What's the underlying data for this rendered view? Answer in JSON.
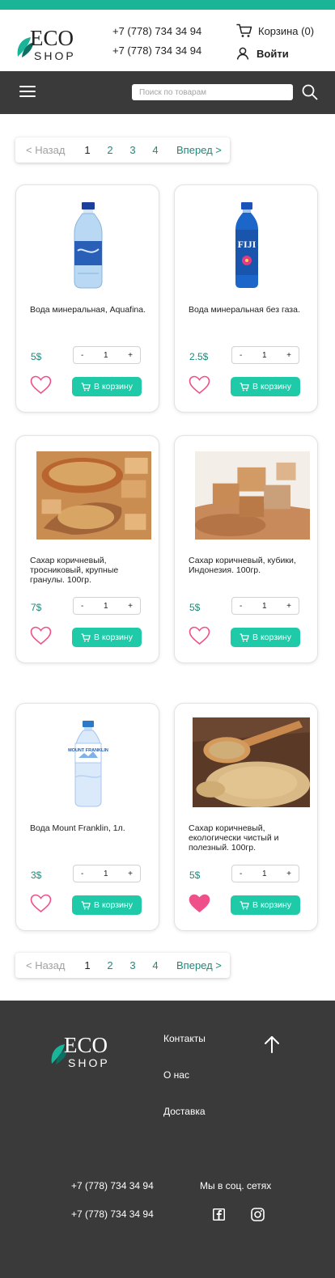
{
  "brand": {
    "logo_letters": "ECO",
    "logo_sub": "SHOP",
    "accent_color": "#1ab598",
    "button_color": "#1fcaa8",
    "heart_color": "#f0508a"
  },
  "header": {
    "phones": [
      "+7 (778) 734 34 94",
      "+7 (778) 734 34 94"
    ],
    "cart_label": "Корзина (0)",
    "cart_icon": "cart-icon",
    "login_label": "Войти",
    "login_icon": "user-icon"
  },
  "navbar": {
    "menu_icon": "hamburger-menu-icon",
    "search_placeholder": "Поиск по товарам",
    "search_icon": "search-icon"
  },
  "pagination": {
    "prev": "< Назад",
    "pages": [
      "1",
      "2",
      "3",
      "4"
    ],
    "current": "1",
    "next": "Вперед >"
  },
  "product_labels": {
    "add_to_cart": "В корзину",
    "minus": "-",
    "plus": "+"
  },
  "products": [
    {
      "name": "Вода минеральная, Aquafina.",
      "price": "5$",
      "quantity": "1",
      "favorite": false,
      "image": "water-bottle-aquafina"
    },
    {
      "name": "Вода минеральная без газа.",
      "price": "2.5$",
      "quantity": "1",
      "favorite": false,
      "image": "water-bottle-fiji",
      "image_text": "FIJI"
    },
    {
      "name": "Сахар коричневый, тросниковый, крупные гранулы. 100гр.",
      "price": "7$",
      "quantity": "1",
      "favorite": false,
      "image": "brown-sugar-bowl"
    },
    {
      "name": "Сахар коричневый, кубики, Индонезия. 100гр.",
      "price": "5$",
      "quantity": "1",
      "favorite": false,
      "image": "brown-sugar-cubes"
    },
    {
      "name": "Вода Mount Franklin, 1л.",
      "price": "3$",
      "quantity": "1",
      "favorite": false,
      "image": "water-bottle-mount-franklin",
      "image_text": "MOUNT FRANKLIN"
    },
    {
      "name": "Сахар коричневый, екологически чистый и полезный. 100гр.",
      "price": "5$",
      "quantity": "1",
      "favorite": true,
      "image": "brown-sugar-spoon"
    }
  ],
  "footer": {
    "links": [
      "Контакты",
      "О нас",
      "Доставка"
    ],
    "phones": [
      "+7 (778) 734 34 94",
      "+7 (778) 734 34 94"
    ],
    "social_title": "Мы в соц. сетях",
    "social_icons": [
      "facebook-icon",
      "instagram-icon"
    ],
    "scroll_up_icon": "arrow-up-icon"
  }
}
